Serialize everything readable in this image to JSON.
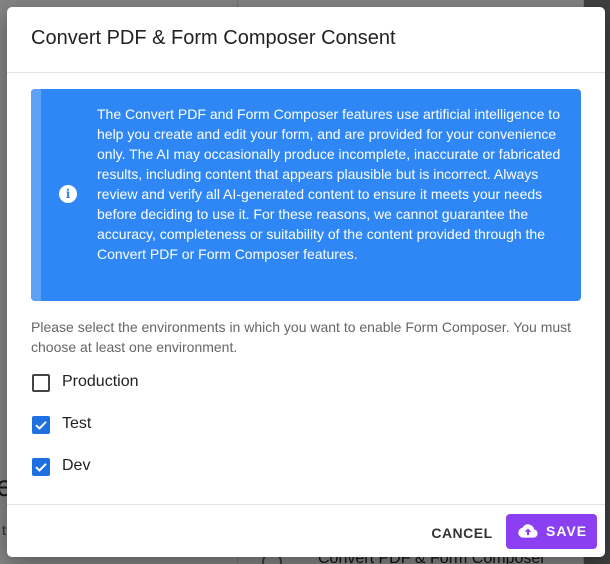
{
  "dialog": {
    "title": "Convert PDF & Form Composer Consent",
    "info_text": "The Convert PDF and Form Composer features use artificial intelligence to help you create and edit your form, and are provided for your convenience only. The AI may occasionally produce incomplete, inaccurate or fabricated results, including content that appears plausible but is incorrect. Always review and verify all AI-generated content to ensure it meets your needs before deciding to use it. For these reasons, we cannot guarantee the accuracy, completeness or suitability of the content provided through the Convert PDF or Form Composer features.",
    "info_icon": "info-icon",
    "prompt": "Please select the environments in which you want to enable Form Composer. You must choose at least one environment.",
    "environments": [
      {
        "label": "Production",
        "checked": false
      },
      {
        "label": "Test",
        "checked": true
      },
      {
        "label": "Dev",
        "checked": true
      }
    ],
    "cancel_label": "CANCEL",
    "save_label": "SAVE",
    "save_icon": "cloud-upload-icon"
  },
  "background": {
    "left_letter": "e",
    "left_sub": "t",
    "right_title": "Convert PDF & Form Composer"
  },
  "colors": {
    "info_blue": "#2e87f5",
    "checkbox_blue": "#1e6fe0",
    "save_purple": "#8a3ff0"
  }
}
